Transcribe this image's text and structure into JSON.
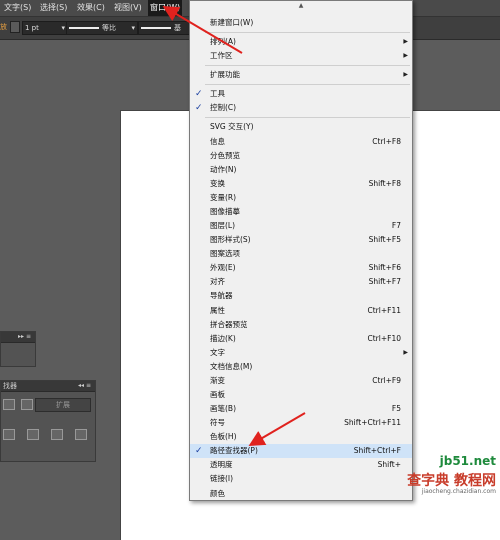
{
  "menubar": {
    "items": [
      {
        "label": "文字(S)"
      },
      {
        "label": "选择(S)"
      },
      {
        "label": "效果(C)"
      },
      {
        "label": "视图(V)"
      },
      {
        "label": "窗口(W)"
      }
    ]
  },
  "controlbar": {
    "prefix": "放",
    "stroke_weight": "1 pt",
    "profile_label": "等比",
    "brush_label": "基"
  },
  "window_menu": {
    "items": [
      {
        "label": "新建窗口(W)"
      },
      {
        "label": "排列(A)",
        "submenu": true
      },
      {
        "label": "工作区",
        "submenu": true
      },
      {
        "label": "扩展功能",
        "submenu": true
      },
      {
        "label": "工具",
        "checked": true
      },
      {
        "label": "控制(C)",
        "checked": true
      },
      {
        "label": "SVG 交互(Y)"
      },
      {
        "label": "信息",
        "shortcut": "Ctrl+F8"
      },
      {
        "label": "分色预览"
      },
      {
        "label": "动作(N)"
      },
      {
        "label": "变换",
        "shortcut": "Shift+F8"
      },
      {
        "label": "变量(R)"
      },
      {
        "label": "图像描摹"
      },
      {
        "label": "图层(L)",
        "shortcut": "F7"
      },
      {
        "label": "图形样式(S)",
        "shortcut": "Shift+F5"
      },
      {
        "label": "图案选项"
      },
      {
        "label": "外观(E)",
        "shortcut": "Shift+F6"
      },
      {
        "label": "对齐",
        "shortcut": "Shift+F7"
      },
      {
        "label": "导航器"
      },
      {
        "label": "属性",
        "shortcut": "Ctrl+F11"
      },
      {
        "label": "拼合器预览"
      },
      {
        "label": "描边(K)",
        "shortcut": "Ctrl+F10"
      },
      {
        "label": "文字",
        "submenu": true
      },
      {
        "label": "文档信息(M)"
      },
      {
        "label": "渐变",
        "shortcut": "Ctrl+F9"
      },
      {
        "label": "画板"
      },
      {
        "label": "画笔(B)",
        "shortcut": "F5"
      },
      {
        "label": "符号",
        "shortcut": "Shift+Ctrl+F11"
      },
      {
        "label": "色板(H)"
      },
      {
        "label": "路径查找器(P)",
        "shortcut": "Shift+Ctrl+F",
        "checked": true,
        "highlighted": true
      },
      {
        "label": "透明度",
        "shortcut": "Shift+"
      },
      {
        "label": "链接(I)"
      },
      {
        "label": "颜色"
      }
    ]
  },
  "pathfinder_panel": {
    "title": "找器",
    "expand_label": "扩展",
    "controls": "◂◂ ≡"
  },
  "small_panel": {
    "controls": "▸▸ ≡"
  },
  "watermark": {
    "domain": "jb51.net",
    "title": "查字典 教程网",
    "url": "jiaocheng.chazidian.com"
  },
  "colors": {
    "annotation_arrow": "#e0221e",
    "menu_highlight": "#cfe3f8",
    "check_mark": "#1a3fa0"
  }
}
